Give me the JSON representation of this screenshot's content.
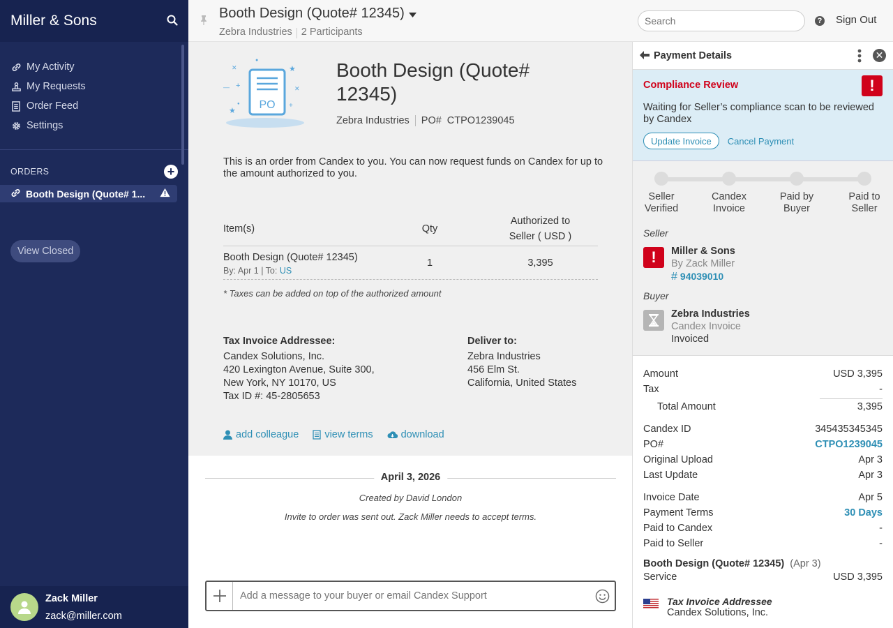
{
  "sidebar": {
    "brand": "Miller & Sons",
    "nav": [
      {
        "label": "My Activity",
        "icon": "link-icon"
      },
      {
        "label": "My Requests",
        "icon": "stamp-icon"
      },
      {
        "label": "Order Feed",
        "icon": "document-icon"
      },
      {
        "label": "Settings",
        "icon": "gear-icon"
      }
    ],
    "orders_label": "ORDERS",
    "order_item": "Booth Design (Quote# 1...",
    "view_closed": "View Closed",
    "user_name": "Zack Miller",
    "user_email": "zack@miller.com"
  },
  "header": {
    "title": "Booth Design (Quote# 12345)",
    "company": "Zebra Industries",
    "participants": "2  Participants",
    "search_placeholder": "Search",
    "sign_out": "Sign Out"
  },
  "document": {
    "title": "Booth Design (Quote# 12345)",
    "company": "Zebra Industries",
    "po_label": "PO#",
    "po_value": "CTPO1239045",
    "intro": "This is an order from Candex to you. You can now request funds on Candex for up to the amount authorized to you.",
    "table": {
      "col_item": "Item(s)",
      "col_qty": "Qty",
      "col_auth_1": "Authorized to",
      "col_auth_2": "Seller ( USD )",
      "row": {
        "item": "Booth Design (Quote# 12345)",
        "by": "By:  Apr 1  |  To:",
        "to": "US",
        "qty": "1",
        "amount": "3,395"
      }
    },
    "tax_note": "* Taxes can be added on top of the authorized amount",
    "tax_addressee": {
      "heading": "Tax Invoice Addressee:",
      "line1": "Candex Solutions, Inc.",
      "line2": "420 Lexington Avenue, Suite 300,",
      "line3": "New York, NY 10170, US",
      "line4": "Tax ID #: 45-2805653"
    },
    "deliver_to": {
      "heading": "Deliver to:",
      "line1": "Zebra Industries",
      "line2": "456 Elm St.",
      "line3": "California, United States"
    },
    "links": {
      "add_colleague": "add colleague",
      "view_terms": "view terms",
      "download": "download"
    }
  },
  "timeline": {
    "date": "April 3, 2026",
    "created": "Created by David London",
    "invite": "Invite to order was sent out. Zack Miller needs to accept terms."
  },
  "composer": {
    "placeholder": "Add a message to your buyer or email Candex Support"
  },
  "panel": {
    "title": "Payment Details",
    "compliance": {
      "title": "Compliance Review",
      "text": "Waiting for Seller’s compliance scan to be reviewed by Candex",
      "update": "Update Invoice",
      "cancel": "Cancel Payment"
    },
    "steps": [
      {
        "l1": "Seller",
        "l2": "Verified"
      },
      {
        "l1": "Candex",
        "l2": "Invoice"
      },
      {
        "l1": "Paid by",
        "l2": "Buyer"
      },
      {
        "l1": "Paid to",
        "l2": "Seller"
      }
    ],
    "seller": {
      "role": "Seller",
      "name": "Miller & Sons",
      "by": "By  Zack Miller",
      "id": "94039010"
    },
    "buyer": {
      "role": "Buyer",
      "name": "Zebra Industries",
      "line1": "Candex Invoice",
      "line2": "Invoiced"
    },
    "details": {
      "amount_label": "Amount",
      "amount_value": "USD  3,395",
      "tax_label": "Tax",
      "tax_value": "-",
      "total_label": "Total Amount",
      "total_value": "3,395",
      "candex_id_label": "Candex ID",
      "candex_id_value": "345435345345",
      "po_label": "PO#",
      "po_value": "CTPO1239045",
      "upload_label": "Original Upload",
      "upload_value": "Apr 3",
      "update_label": "Last Update",
      "update_value": "Apr 3",
      "invoice_date_label": "Invoice Date",
      "invoice_date_value": "Apr 5",
      "terms_label": "Payment Terms",
      "terms_value": "30 Days",
      "paid_candex_label": "Paid to Candex",
      "paid_candex_value": "-",
      "paid_seller_label": "Paid to Seller",
      "paid_seller_value": "-"
    },
    "line_item": {
      "title": "Booth Design (Quote# 12345)",
      "date": "(Apr 3)",
      "service_label": "Service",
      "service_value": "USD  3,395"
    },
    "tax_addressee": {
      "heading": "Tax Invoice Addressee",
      "value": "Candex Solutions, Inc."
    }
  },
  "colors": {
    "sidebar": "#1d2a5a",
    "accent": "#2e8fb5",
    "alert": "#d0021b"
  }
}
